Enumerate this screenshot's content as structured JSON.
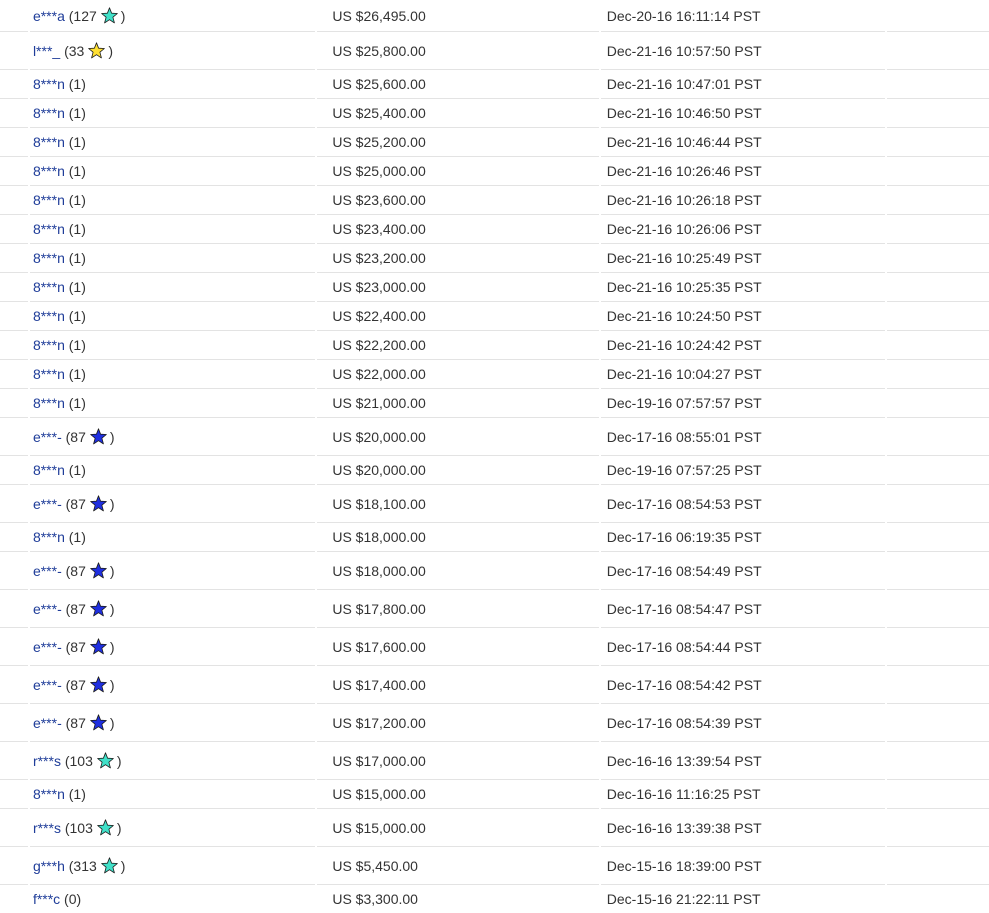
{
  "colors": {
    "link": "#1f3d99",
    "text": "#333333",
    "divider": "#e3e3e3",
    "star_turquoise": "#40e0c8",
    "star_yellow": "#ffe033",
    "star_blue": "#1f2fe0"
  },
  "bids": [
    {
      "bidder": "e***a",
      "score": "127",
      "star": "turquoise",
      "star_icon": "turquoise-star-icon",
      "amount": "US $26,495.00",
      "time": "Dec-20-16 16:11:14 PST"
    },
    {
      "bidder": "l***_",
      "score": "33",
      "star": "yellow",
      "star_icon": "yellow-star-icon",
      "amount": "US $25,800.00",
      "time": "Dec-21-16 10:57:50 PST"
    },
    {
      "bidder": "8***n",
      "score": "1",
      "star": "",
      "amount": "US $25,600.00",
      "time": "Dec-21-16 10:47:01 PST"
    },
    {
      "bidder": "8***n",
      "score": "1",
      "star": "",
      "amount": "US $25,400.00",
      "time": "Dec-21-16 10:46:50 PST"
    },
    {
      "bidder": "8***n",
      "score": "1",
      "star": "",
      "amount": "US $25,200.00",
      "time": "Dec-21-16 10:46:44 PST"
    },
    {
      "bidder": "8***n",
      "score": "1",
      "star": "",
      "amount": "US $25,000.00",
      "time": "Dec-21-16 10:26:46 PST"
    },
    {
      "bidder": "8***n",
      "score": "1",
      "star": "",
      "amount": "US $23,600.00",
      "time": "Dec-21-16 10:26:18 PST"
    },
    {
      "bidder": "8***n",
      "score": "1",
      "star": "",
      "amount": "US $23,400.00",
      "time": "Dec-21-16 10:26:06 PST"
    },
    {
      "bidder": "8***n",
      "score": "1",
      "star": "",
      "amount": "US $23,200.00",
      "time": "Dec-21-16 10:25:49 PST"
    },
    {
      "bidder": "8***n",
      "score": "1",
      "star": "",
      "amount": "US $23,000.00",
      "time": "Dec-21-16 10:25:35 PST"
    },
    {
      "bidder": "8***n",
      "score": "1",
      "star": "",
      "amount": "US $22,400.00",
      "time": "Dec-21-16 10:24:50 PST"
    },
    {
      "bidder": "8***n",
      "score": "1",
      "star": "",
      "amount": "US $22,200.00",
      "time": "Dec-21-16 10:24:42 PST"
    },
    {
      "bidder": "8***n",
      "score": "1",
      "star": "",
      "amount": "US $22,000.00",
      "time": "Dec-21-16 10:04:27 PST"
    },
    {
      "bidder": "8***n",
      "score": "1",
      "star": "",
      "amount": "US $21,000.00",
      "time": "Dec-19-16 07:57:57 PST"
    },
    {
      "bidder": "e***-",
      "score": "87",
      "star": "blue",
      "star_icon": "blue-star-icon",
      "amount": "US $20,000.00",
      "time": "Dec-17-16 08:55:01 PST"
    },
    {
      "bidder": "8***n",
      "score": "1",
      "star": "",
      "amount": "US $20,000.00",
      "time": "Dec-19-16 07:57:25 PST"
    },
    {
      "bidder": "e***-",
      "score": "87",
      "star": "blue",
      "star_icon": "blue-star-icon",
      "amount": "US $18,100.00",
      "time": "Dec-17-16 08:54:53 PST"
    },
    {
      "bidder": "8***n",
      "score": "1",
      "star": "",
      "amount": "US $18,000.00",
      "time": "Dec-17-16 06:19:35 PST"
    },
    {
      "bidder": "e***-",
      "score": "87",
      "star": "blue",
      "star_icon": "blue-star-icon",
      "amount": "US $18,000.00",
      "time": "Dec-17-16 08:54:49 PST"
    },
    {
      "bidder": "e***-",
      "score": "87",
      "star": "blue",
      "star_icon": "blue-star-icon",
      "amount": "US $17,800.00",
      "time": "Dec-17-16 08:54:47 PST"
    },
    {
      "bidder": "e***-",
      "score": "87",
      "star": "blue",
      "star_icon": "blue-star-icon",
      "amount": "US $17,600.00",
      "time": "Dec-17-16 08:54:44 PST"
    },
    {
      "bidder": "e***-",
      "score": "87",
      "star": "blue",
      "star_icon": "blue-star-icon",
      "amount": "US $17,400.00",
      "time": "Dec-17-16 08:54:42 PST"
    },
    {
      "bidder": "e***-",
      "score": "87",
      "star": "blue",
      "star_icon": "blue-star-icon",
      "amount": "US $17,200.00",
      "time": "Dec-17-16 08:54:39 PST"
    },
    {
      "bidder": "r***s",
      "score": "103",
      "star": "turquoise",
      "star_icon": "turquoise-star-icon",
      "amount": "US $17,000.00",
      "time": "Dec-16-16 13:39:54 PST"
    },
    {
      "bidder": "8***n",
      "score": "1",
      "star": "",
      "amount": "US $15,000.00",
      "time": "Dec-16-16 11:16:25 PST"
    },
    {
      "bidder": "r***s",
      "score": "103",
      "star": "turquoise",
      "star_icon": "turquoise-star-icon",
      "amount": "US $15,000.00",
      "time": "Dec-16-16 13:39:38 PST"
    },
    {
      "bidder": "g***h",
      "score": "313",
      "star": "turquoise",
      "star_icon": "turquoise-star-icon",
      "amount": "US $5,450.00",
      "time": "Dec-15-16 18:39:00 PST"
    },
    {
      "bidder": "f***c",
      "score": "0",
      "star": "",
      "amount": "US $3,300.00",
      "time": "Dec-15-16 21:22:11 PST"
    }
  ]
}
